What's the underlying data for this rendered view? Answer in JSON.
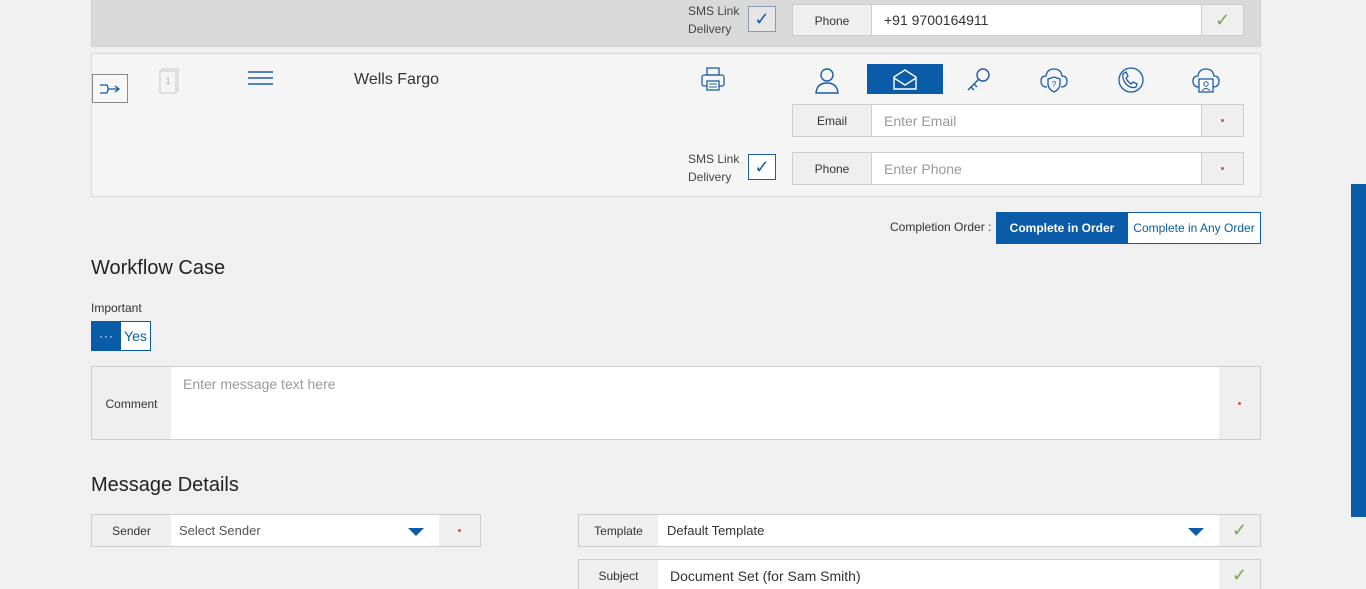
{
  "top_recipient": {
    "sms_label": "SMS Link Delivery",
    "phone_label": "Phone",
    "phone_value": "+91 9700164911"
  },
  "recipient": {
    "name": "Wells Fargo",
    "sms_label": "SMS Link Delivery",
    "email_label": "Email",
    "email_placeholder": "Enter Email",
    "phone_label": "Phone",
    "phone_placeholder": "Enter Phone"
  },
  "completion_order": {
    "label": "Completion Order :",
    "options": [
      "Complete in Order",
      "Complete in Any Order"
    ],
    "selected": "Complete in Order"
  },
  "workflow": {
    "title": "Workflow Case",
    "important_label": "Important",
    "toggle_knob": "···",
    "toggle_value": "Yes",
    "comment_label": "Comment",
    "comment_placeholder": "Enter message text here"
  },
  "message": {
    "title": "Message Details",
    "sender_label": "Sender",
    "sender_value": "Select Sender",
    "template_label": "Template",
    "template_value": "Default Template",
    "subject_label": "Subject",
    "subject_value": "Document Set (for Sam Smith)"
  },
  "colors": {
    "accent": "#0a5ba8",
    "check_ok": "#7aa84a",
    "required": "#d9534f"
  }
}
